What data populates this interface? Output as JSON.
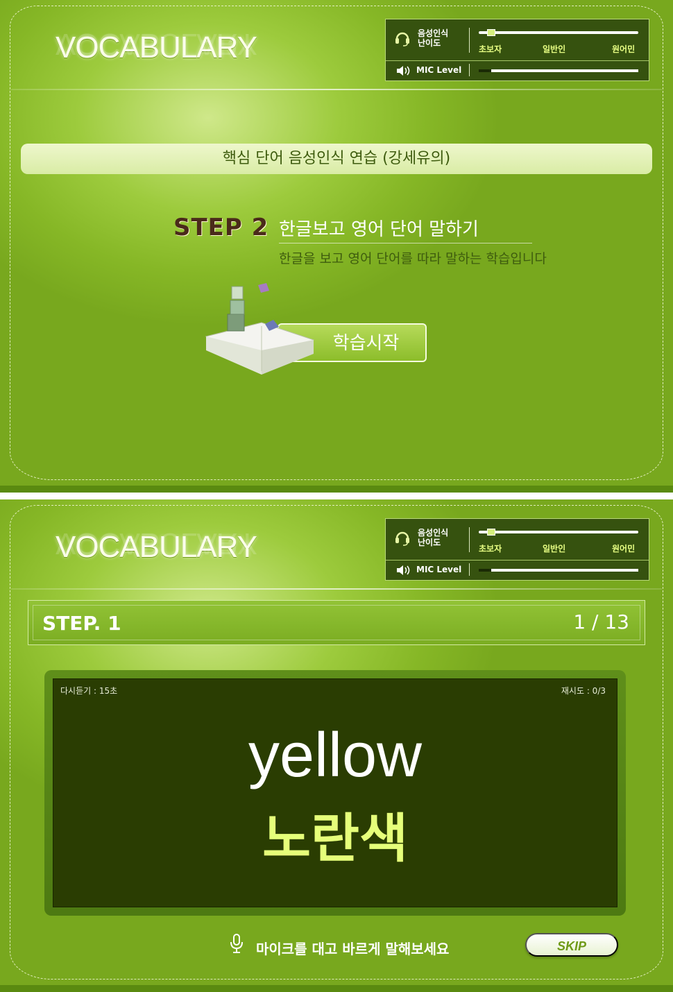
{
  "header": {
    "logo_text": "VOCABULARY",
    "difficulty_label_line1": "음성인식",
    "difficulty_label_line2": "난이도",
    "levels": [
      "초보자",
      "일반인",
      "원어민"
    ],
    "mic_label": "MIC Level",
    "difficulty_value": 0.05,
    "mic_level_value": 0.08
  },
  "intro": {
    "lesson_title": "핵심 단어 음성인식 연습 (강세유의)",
    "step_badge": "STEP 2",
    "step_title": "한글보고 영어 단어 말하기",
    "step_desc": "한글을 보고 영어 단어를 따라 말하는 학습입니다",
    "start_button": "학습시작"
  },
  "practice": {
    "step_name": "STEP. 1",
    "progress": "1 / 13",
    "replay_timer": "다시듣기 : 15초",
    "retry_count": "재시도 : 0/3",
    "word_en": "yellow",
    "word_ko": "노란색",
    "speak_hint": "마이크를 대고 바르게 말해보세요",
    "skip_button": "SKIP"
  },
  "colors": {
    "panel_green": "#86b726",
    "screen_dark": "#2a3d02",
    "word_yellow": "#e6ff7a"
  },
  "icons": [
    "headset-icon",
    "speaker-icon",
    "microphone-icon",
    "book-icon"
  ]
}
